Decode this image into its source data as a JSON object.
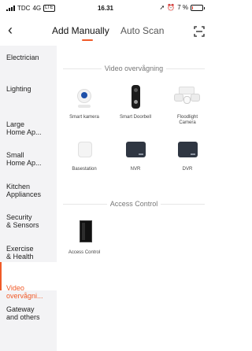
{
  "status_bar": {
    "carrier": "TDC",
    "network": "4G",
    "network_badge": "LTE",
    "time": "16.31",
    "battery_percent": "7 %",
    "battery_level": 0.07
  },
  "header": {
    "back_icon": "chevron-left-icon",
    "tabs": [
      {
        "label": "Add Manually",
        "active": true
      },
      {
        "label": "Auto Scan",
        "active": false
      }
    ],
    "scan_icon": "scan-frame-icon",
    "accent_color": "#f05a28"
  },
  "sidebar": {
    "items": [
      {
        "label": "Electrician"
      },
      {
        "label": "Lighting"
      },
      {
        "label": "Large\nHome Ap..."
      },
      {
        "label": "Small\nHome Ap..."
      },
      {
        "label": "Kitchen\nAppliances"
      },
      {
        "label": "Security\n& Sensors"
      },
      {
        "label": "Exercise\n& Health"
      },
      {
        "label": "Video\novervågni...",
        "active": true
      },
      {
        "label": "Gateway\nand others"
      }
    ]
  },
  "main": {
    "sections": [
      {
        "title": "Video overvågning",
        "devices": [
          {
            "label": "Smart kamera"
          },
          {
            "label": "Smart Doorbell"
          },
          {
            "label": "Floodlight\nCamera"
          },
          {
            "label": "Basestation"
          },
          {
            "label": "NVR"
          },
          {
            "label": "DVR"
          }
        ]
      },
      {
        "title": "Access Control",
        "devices": [
          {
            "label": "Access Control"
          }
        ]
      }
    ]
  }
}
